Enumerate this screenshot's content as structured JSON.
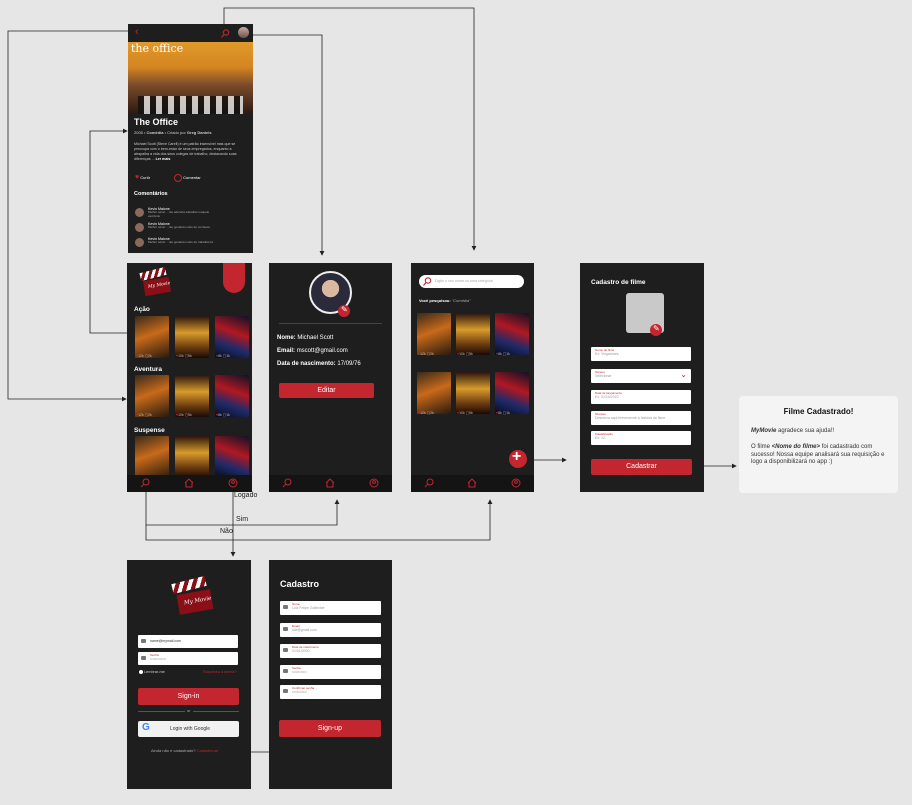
{
  "show": {
    "title": "The Office",
    "poster_title": "the office",
    "meta_year": "2005",
    "meta_genre": "Comédia",
    "meta_creator_prefix": "Criado por",
    "meta_creator": "Greg Daniels",
    "synopsis": "Michael Scott (Steve Carell) é um patrão insensível mas que se preocupa com o bem-estar de seus empregados, enquanto a atrapalha a vida dos seus colegas de trabalho, destacando suas diferenças ...",
    "read_more": "Ler mais",
    "like_label": "Curtir",
    "comment_label": "Comentar",
    "comments_heading": "Comentários",
    "comments": [
      {
        "author": "Kevin Malone",
        "text": "Melhor série! ... Eu adoraria trabalhar naquele escritório"
      },
      {
        "author": "Kevin Malone",
        "text": "Melhor série! ... Eu gostaria muito de conhecer"
      },
      {
        "author": "Kevin Malone",
        "text": "Melhor série! ... Eu gostaria muito de trabalhar lá"
      }
    ]
  },
  "logo_text": "My Movie",
  "home": {
    "categories": [
      "Ação",
      "Aventura",
      "Suspense"
    ],
    "stats": [
      {
        "likes": "12k",
        "comments": "2k"
      },
      {
        "likes": "10k",
        "comments": "5k"
      },
      {
        "likes": "8k",
        "comments": "1k"
      }
    ]
  },
  "profile": {
    "name_label": "Nome:",
    "name_value": "Michael Scott",
    "email_label": "Email:",
    "email_value": "mscott@gmail.com",
    "birth_label": "Data de nascimento:",
    "birth_value": "17/09/76",
    "edit_button": "Editar"
  },
  "search": {
    "placeholder": "Digite o seu nome ou uma categoria",
    "you_searched_label": "Você pesquisou:",
    "you_searched_value": "\"Comédia\""
  },
  "register_movie": {
    "title": "Cadastro de filme",
    "fields": [
      {
        "label": "Nome do filme",
        "value": "Ex: Vingadores"
      },
      {
        "label": "Gênero",
        "value": "Selecionar"
      },
      {
        "label": "Data de lançamento",
        "value": "Ex: 01/10/2020"
      },
      {
        "label": "Sinopse",
        "value": "Descreva aqui brevemente a história do filme"
      },
      {
        "label": "Classificação",
        "value": "Ex: 12"
      }
    ],
    "submit_button": "Cadastrar"
  },
  "success_card": {
    "title": "Filme Cadastrado!",
    "brand": "MyMovie",
    "thanks_suffix": " agradece sua ajuda!!",
    "msg_prefix": "O filme ",
    "msg_placeholder": "<Nome do filme>",
    "msg_suffix": " foi cadastrado com sucesso! Nossa equipe analisará sua requisição e logo a disponibilizará no app :)"
  },
  "login": {
    "email_value": "name@mymail.com",
    "password_label": "Senha",
    "password_value": "•••••••••••••",
    "remember_me": "Lembrar-me",
    "forgot_password": "Esqueceu a senha?",
    "signin_button": "Sign-in",
    "or": "or",
    "google_button": "Login with Google",
    "no_account": "Ainda não é cadastrado?",
    "register_link": "Cadastre-se"
  },
  "signup": {
    "title": "Cadastro",
    "fields": [
      {
        "label": "Nome",
        "placeholder": "Luiz Felipe Gollecker"
      },
      {
        "label": "Email",
        "placeholder": "luiz@gmail.com"
      },
      {
        "label": "Data de nascimento",
        "placeholder": "01/01/2000"
      },
      {
        "label": "Senha",
        "placeholder": "••••••••••••"
      },
      {
        "label": "Confirmar senha",
        "placeholder": "••••••••••••"
      }
    ],
    "signup_button": "Sign-up"
  },
  "flow_labels": {
    "logged": "Logado",
    "yes": "Sim",
    "no": "Não"
  },
  "colors": {
    "accent": "#c3262e",
    "screen_bg": "#1e1e1e",
    "canvas_bg": "#e6e6e6"
  }
}
